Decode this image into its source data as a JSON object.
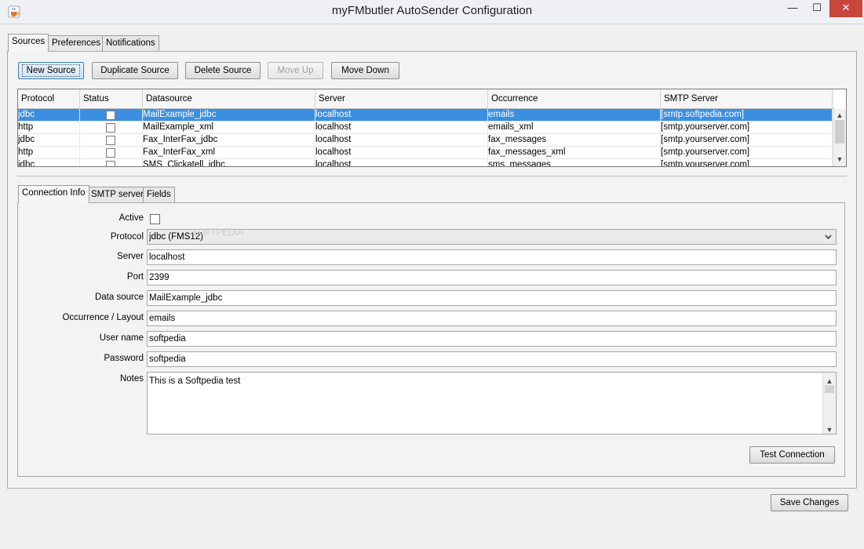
{
  "window": {
    "title": "myFMbutler AutoSender Configuration",
    "controls": {
      "minimize": "—",
      "maximize": "☐",
      "close": "✕"
    }
  },
  "tabs": {
    "sources": "Sources",
    "preferences": "Preferences",
    "notifications": "Notifications"
  },
  "toolbar": {
    "new_source": "New Source",
    "duplicate_source": "Duplicate Source",
    "delete_source": "Delete Source",
    "move_up": "Move Up",
    "move_down": "Move Down"
  },
  "table": {
    "headers": [
      "Protocol",
      "Status",
      "Datasource",
      "Server",
      "Occurrence",
      "SMTP Server"
    ],
    "rows": [
      {
        "protocol": "jdbc",
        "status": false,
        "datasource": "MailExample_jdbc",
        "server": "localhost",
        "occurrence": "emails",
        "smtp": "[smtp.softpedia.com]",
        "selected": true
      },
      {
        "protocol": "http",
        "status": false,
        "datasource": "MailExample_xml",
        "server": "localhost",
        "occurrence": "emails_xml",
        "smtp": "[smtp.yourserver.com]",
        "selected": false
      },
      {
        "protocol": "jdbc",
        "status": false,
        "datasource": "Fax_InterFax_jdbc",
        "server": "localhost",
        "occurrence": "fax_messages",
        "smtp": "[smtp.yourserver.com]",
        "selected": false
      },
      {
        "protocol": "http",
        "status": false,
        "datasource": "Fax_InterFax_xml",
        "server": "localhost",
        "occurrence": "fax_messages_xml",
        "smtp": "[smtp.yourserver.com]",
        "selected": false
      },
      {
        "protocol": "jdbc",
        "status": false,
        "datasource": "SMS_Clickatell_jdbc",
        "server": "localhost",
        "occurrence": "sms_messages",
        "smtp": "[smtp.yourserver.com]",
        "selected": false
      }
    ]
  },
  "subtabs": {
    "connection_info": "Connection Info",
    "smtp_server": "SMTP server",
    "fields": "Fields"
  },
  "form": {
    "active_label": "Active",
    "protocol_label": "Protocol",
    "protocol_value": "jdbc (FMS12)",
    "server_label": "Server",
    "server_value": "localhost",
    "port_label": "Port",
    "port_value": "2399",
    "datasource_label": "Data source",
    "datasource_value": "MailExample_jdbc",
    "occurrence_label": "Occurrence / Layout",
    "occurrence_value": "emails",
    "username_label": "User name",
    "username_value": "softpedia",
    "password_label": "Password",
    "password_value": "softpedia",
    "notes_label": "Notes",
    "notes_value": "This is a Softpedia test",
    "watermark": "SOFTPEDIA"
  },
  "buttons": {
    "test_connection": "Test Connection",
    "save_changes": "Save Changes"
  },
  "icons": {
    "app": "java-cup-icon",
    "dropdown": "chevron-down-icon",
    "scroll_up": "arrow-up-icon",
    "scroll_down": "arrow-down-icon"
  },
  "colors": {
    "selection": "#3b8fe1",
    "close_button": "#c7473e"
  }
}
